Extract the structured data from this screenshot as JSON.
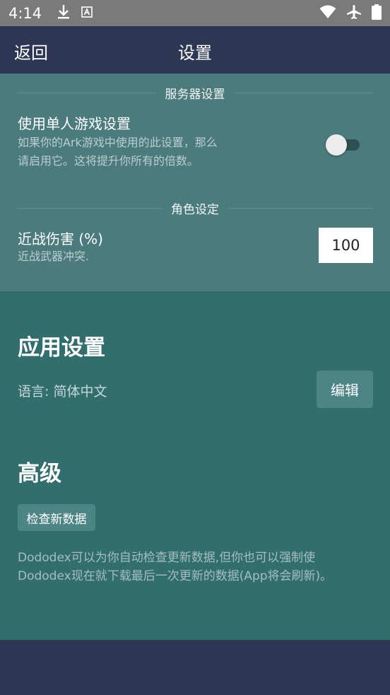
{
  "status_bar": {
    "time": "4:14",
    "left_icons": [
      "download-icon",
      "font-a-icon"
    ],
    "right_icons": [
      "wifi-icon",
      "airplane-icon",
      "battery-icon"
    ]
  },
  "app_bar": {
    "back_label": "返回",
    "title": "设置"
  },
  "server_settings": {
    "section_label": "服务器设置",
    "single_player": {
      "title": "使用单人游戏设置",
      "desc_line1": "如果你的Ark游戏中使用的此设置，那么",
      "desc_line2": "请启用它。这将提升你所有的倍数。",
      "enabled": false
    }
  },
  "character_settings": {
    "section_label": "角色设定",
    "melee": {
      "title": "近战伤害 (%)",
      "desc": "近战武器冲突.",
      "value": "100"
    }
  },
  "app_settings": {
    "heading": "应用设置",
    "language_text": "语言: 简体中文",
    "edit_label": "编辑"
  },
  "advanced": {
    "heading": "高级",
    "check_label": "检查新数据",
    "info_line1": "Dododex可以为你自动检查更新数据,但你也可以强制使",
    "info_line2": "Dododex现在就下载最后一次更新的数据(App将会刷新)。"
  },
  "colors": {
    "app_bar": "#2d3653",
    "server_panel": "#4b7b7c",
    "app_panel": "#336e6f",
    "button": "#4d8485"
  }
}
